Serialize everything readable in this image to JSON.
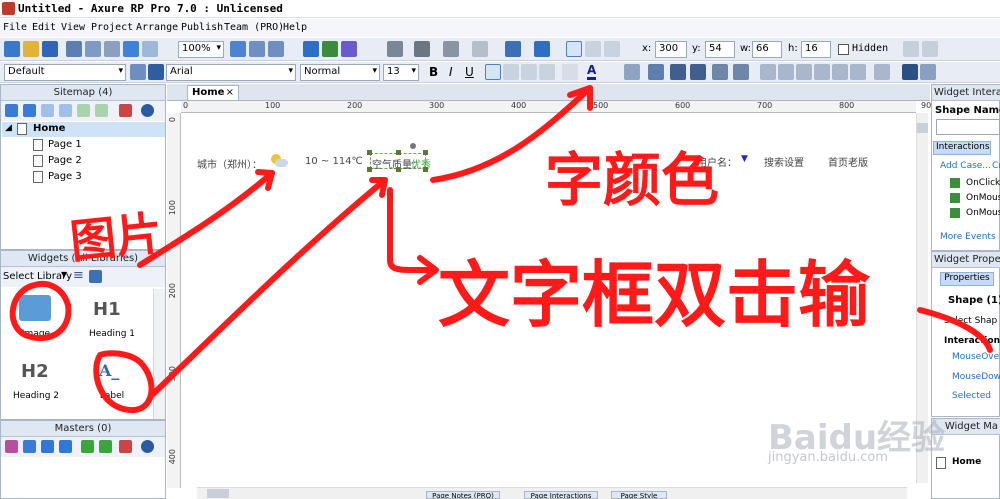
{
  "window": {
    "title": "Untitled - Axure RP Pro 7.0 : Unlicensed"
  },
  "menu": [
    "File",
    "Edit",
    "View",
    "Project",
    "Arrange",
    "Publish",
    "Team (PRO)",
    "Help"
  ],
  "toolbar": {
    "zoom": "100%",
    "x_label": "x:",
    "x": "300",
    "y_label": "y:",
    "y": "54",
    "w_label": "w:",
    "w": "66",
    "h_label": "h:",
    "h": "16",
    "hidden_label": "Hidden",
    "style": "Default",
    "font": "Arial",
    "weight": "Normal",
    "size": "13"
  },
  "sitemap": {
    "title": "Sitemap (4)",
    "root": "Home",
    "pages": [
      "Page 1",
      "Page 2",
      "Page 3"
    ]
  },
  "widgets": {
    "title": "Widgets (All Libraries)",
    "select_library": "Select Library",
    "items": [
      {
        "label": "Image"
      },
      {
        "label": "Heading 1",
        "glyph": "H1"
      },
      {
        "label": "Heading 2",
        "glyph": "H2"
      },
      {
        "label": "Label",
        "glyph": "A_"
      }
    ]
  },
  "masters": {
    "title": "Masters (0)"
  },
  "canvas": {
    "tab": "Home",
    "ruler": [
      "0",
      "100",
      "200",
      "300",
      "400",
      "500",
      "600",
      "700",
      "800",
      "900"
    ],
    "vruler": [
      "0",
      "100",
      "200",
      "300",
      "400"
    ],
    "city": "城市（郑州）：",
    "temp": "10 ~ 114℃",
    "air": "空气质量：",
    "air_value": "优秀",
    "user": "用户名：",
    "search": "搜索设置",
    "old": "首页老版"
  },
  "bottom_tabs": [
    "Page Notes (PRO)",
    "Page Interactions",
    "Page Style"
  ],
  "interactions": {
    "title": "Widget Interactio",
    "shape_name": "Shape Name",
    "tab": "Interactions",
    "add_case": "Add Case...",
    "create": "Cr",
    "events": [
      "OnClick",
      "OnMous",
      "OnMous"
    ],
    "more": "More Events"
  },
  "properties": {
    "title": "Widget Propertie",
    "tab": "Properties",
    "shape": "Shape (1)",
    "select_shape": "Select Shap",
    "interaction_s": "Interaction S",
    "items": [
      "MouseOver",
      "MouseDown",
      "Selected"
    ]
  },
  "widget_manager": {
    "title": "Widget Ma",
    "home": "Home"
  },
  "annotations": {
    "picture": "图片",
    "text_color": "字颜色",
    "text_box": "文字框双击输"
  },
  "watermark": {
    "brand": "Baidu经验",
    "url": "jingyan.baidu.com"
  },
  "colors": {
    "annotation": "#ff1a1a",
    "accent": "#1e6fd1",
    "panel_head": "#dfe7f2"
  }
}
